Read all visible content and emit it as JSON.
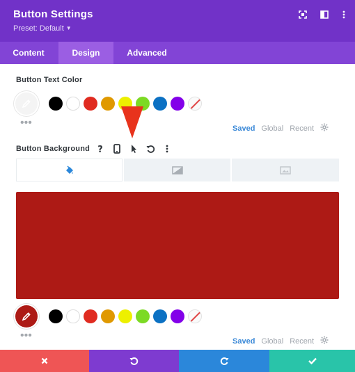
{
  "header": {
    "title": "Button Settings",
    "preset_label": "Preset: Default",
    "icons": [
      "fullscreen-icon",
      "split-view-icon",
      "more-vertical-icon"
    ]
  },
  "tabs": [
    {
      "label": "Content",
      "active": false
    },
    {
      "label": "Design",
      "active": true
    },
    {
      "label": "Advanced",
      "active": false
    }
  ],
  "text_color": {
    "label": "Button Text Color",
    "current_color": "#ffffff",
    "swatches": [
      "#000000",
      "#ffffff",
      "#e02b20",
      "#e09900",
      "#edf000",
      "#7cda24",
      "#0c71c3",
      "#8300e9",
      "none"
    ],
    "palette_tabs": [
      "Saved",
      "Global",
      "Recent"
    ],
    "active_palette_tab": "Saved"
  },
  "background": {
    "label": "Button Background",
    "option_icons": [
      "help-icon",
      "mobile-icon",
      "hover-cursor-icon",
      "reset-icon",
      "more-vertical-icon"
    ],
    "type_tabs": [
      "paint-bucket-icon",
      "gradient-icon",
      "image-icon"
    ],
    "active_type_tab": "paint-bucket-icon",
    "color": "#ad1a15",
    "swatches": [
      "#000000",
      "#ffffff",
      "#e02b20",
      "#e09900",
      "#edf000",
      "#7cda24",
      "#0c71c3",
      "#8300e9",
      "none"
    ],
    "palette_tabs": [
      "Saved",
      "Global",
      "Recent"
    ],
    "active_palette_tab": "Saved"
  },
  "footer": {
    "buttons": [
      {
        "name": "discard",
        "icon": "close-icon",
        "color": "#ef5555"
      },
      {
        "name": "undo",
        "icon": "undo-icon",
        "color": "#7e3bd0"
      },
      {
        "name": "redo",
        "icon": "redo-icon",
        "color": "#2b87da"
      },
      {
        "name": "save",
        "icon": "checkmark-icon",
        "color": "#29c4a9"
      }
    ]
  },
  "colors": {
    "header": "#7132c8",
    "tabs": "#8244d6",
    "tab_active": "#9b5ee3",
    "annotation_arrow": "#e8331c"
  }
}
